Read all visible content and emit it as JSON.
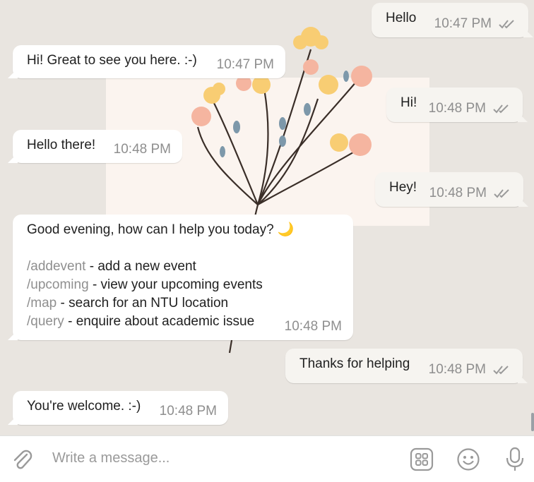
{
  "messages": [
    {
      "dir": "out",
      "text": "Hello",
      "time": "10:47 PM"
    },
    {
      "dir": "in",
      "text": "Hi! Great to see you here. :-)",
      "time": "10:47 PM"
    },
    {
      "dir": "out",
      "text": "Hi!",
      "time": "10:48 PM"
    },
    {
      "dir": "in",
      "text": "Hello there!",
      "time": "10:48 PM"
    },
    {
      "dir": "out",
      "text": "Hey!",
      "time": "10:48 PM"
    },
    {
      "dir": "in",
      "greeting": "Good evening, how can I help you today? 🌙",
      "commands": [
        {
          "cmd": "/addevent",
          "desc": " - add a new event"
        },
        {
          "cmd": "/upcoming",
          "desc": " - view your upcoming events"
        },
        {
          "cmd": "/map",
          "desc": " - search for an NTU location"
        },
        {
          "cmd": "/query",
          "desc": " - enquire about academic issue"
        }
      ],
      "time": "10:48 PM"
    },
    {
      "dir": "out",
      "text": "Thanks for helping",
      "time": "10:48 PM"
    },
    {
      "dir": "in",
      "text": "You're welcome. :-)",
      "time": "10:48 PM"
    }
  ],
  "composer": {
    "placeholder": "Write a message...",
    "icons": [
      "paperclip-icon",
      "bot-menu-icon",
      "emoji-icon",
      "microphone-icon"
    ]
  },
  "colors": {
    "accent_ticks": "#8e8e8e",
    "command_text": "#8f8f8f",
    "incoming_bg": "#ffffff",
    "outgoing_bg": "#f6f4f0"
  }
}
